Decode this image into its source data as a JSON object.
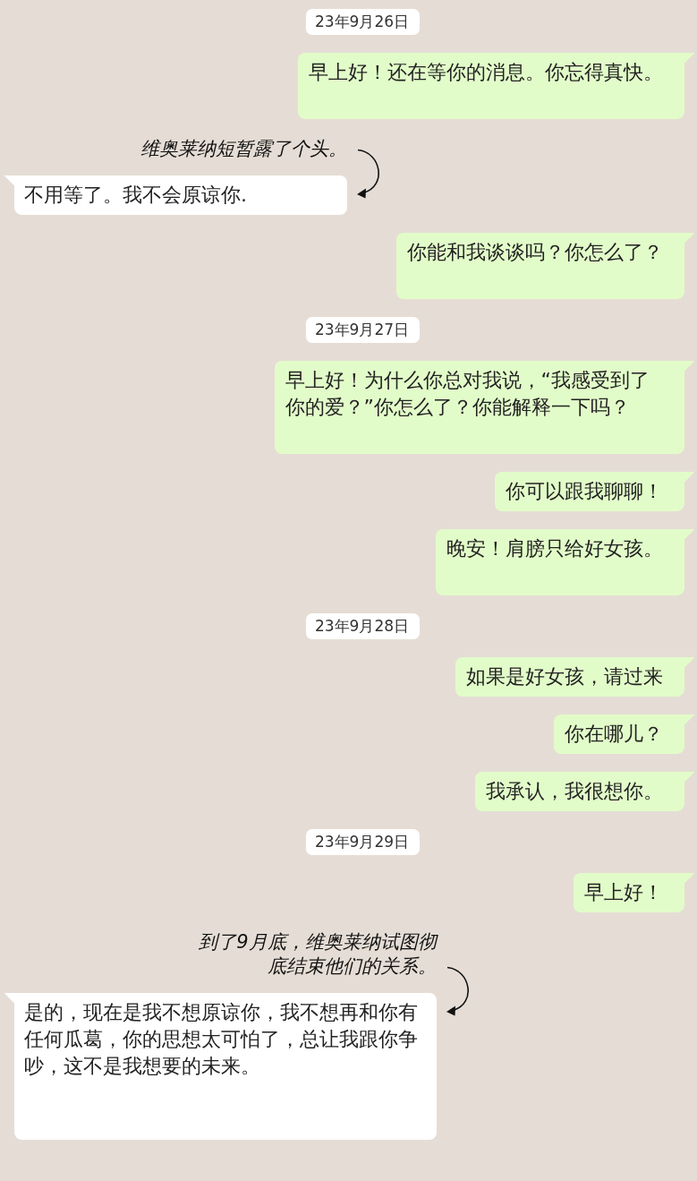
{
  "conversation": [
    {
      "kind": "date",
      "text": "23年9月26日"
    },
    {
      "kind": "outgoing",
      "text": "早上好！还在等你的消息。你忘得真快。",
      "padded": true
    },
    {
      "kind": "narrated",
      "caption": "维奥莱纳短暂露了个头。",
      "reply": {
        "text": "不用等了。我不会原谅你.",
        "padded": false
      }
    },
    {
      "kind": "outgoing",
      "text": "你能和我谈谈吗？你怎么了？",
      "padded": true
    },
    {
      "kind": "date",
      "text": "23年9月27日"
    },
    {
      "kind": "outgoing",
      "text": "早上好！为什么你总对我说，“我感受到了你的爱？”你怎么了？你能解释一下吗？",
      "padded": true
    },
    {
      "kind": "outgoing",
      "text": "你可以跟我聊聊！",
      "padded": false
    },
    {
      "kind": "outgoing",
      "text": "晚安！肩膀只给好女孩。",
      "padded": true
    },
    {
      "kind": "date",
      "text": "23年9月28日"
    },
    {
      "kind": "outgoing",
      "text": "如果是好女孩，请过来",
      "padded": false
    },
    {
      "kind": "outgoing",
      "text": "你在哪儿？",
      "padded": false
    },
    {
      "kind": "outgoing",
      "text": "我承认，我很想你。",
      "padded": false
    },
    {
      "kind": "date",
      "text": "23年9月29日"
    },
    {
      "kind": "outgoing",
      "text": "早上好！",
      "padded": false
    },
    {
      "kind": "narrated",
      "caption": "到了9月底，维奥莱纳试图彻底结束他们的关系。",
      "reply": {
        "text": "是的，现在是我不想原谅你，我不想再和你有任何瓜葛，你的思想太可怕了，总让我跟你争吵，这不是我想要的未来。",
        "padded": true
      }
    }
  ]
}
